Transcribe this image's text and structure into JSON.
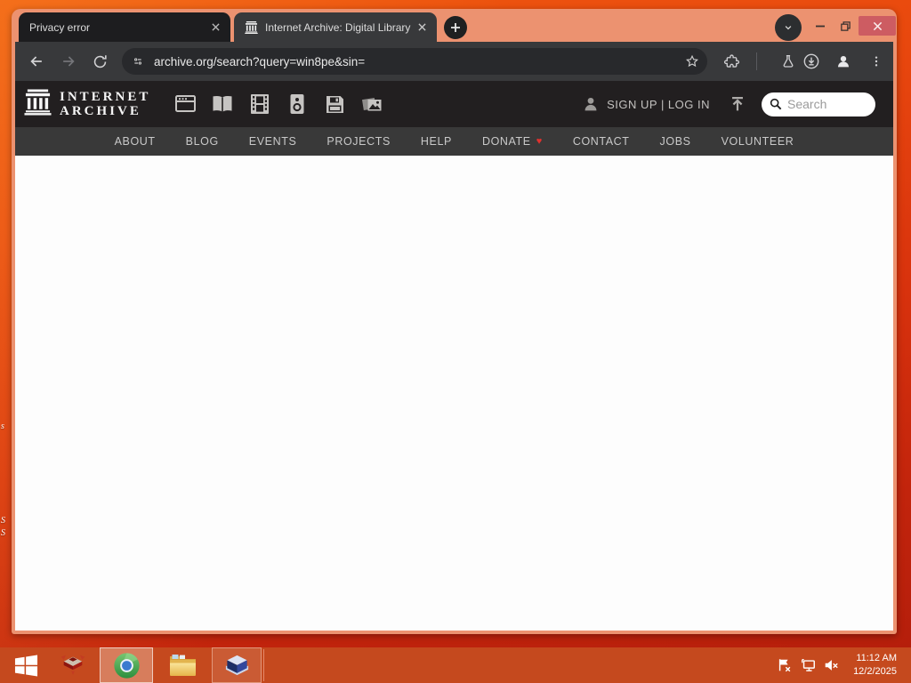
{
  "titlebar": {
    "tabs": [
      {
        "title": "Privacy error"
      },
      {
        "title": "Internet Archive: Digital Library"
      }
    ]
  },
  "toolbar": {
    "url": "archive.org/search?query=win8pe&sin="
  },
  "ia": {
    "logo_line1": "INTERNET",
    "logo_line2": "ARCHIVE",
    "auth_text": "SIGN UP | LOG IN",
    "search_placeholder": "Search",
    "media_types": [
      "web",
      "texts",
      "video",
      "audio",
      "software",
      "images"
    ],
    "nav": [
      "ABOUT",
      "BLOG",
      "EVENTS",
      "PROJECTS",
      "HELP",
      "DONATE",
      "CONTACT",
      "JOBS",
      "VOLUNTEER"
    ]
  },
  "taskbar": {
    "clock": {
      "time": "11:12 AM",
      "date": "12/2/2025"
    }
  },
  "desktop": {
    "label_fragments": [
      "s",
      "S",
      "S"
    ]
  },
  "icons": {
    "donate_heart": "♥"
  },
  "colors": {
    "wallpaper_top": "#f05a0e",
    "wallpaper_bottom": "#b21d0b",
    "window_frame": "#ec9270",
    "close_button": "#cd5c62",
    "toolbar_bg": "#38393b",
    "inactive_tab_bg": "#1d1d1f",
    "omnibox_bg": "#28292c",
    "ia_header_bg": "#221f20",
    "ia_nav_bg": "#393939",
    "taskbar_bg": "#c5491e",
    "heart_red": "#e0312e"
  }
}
